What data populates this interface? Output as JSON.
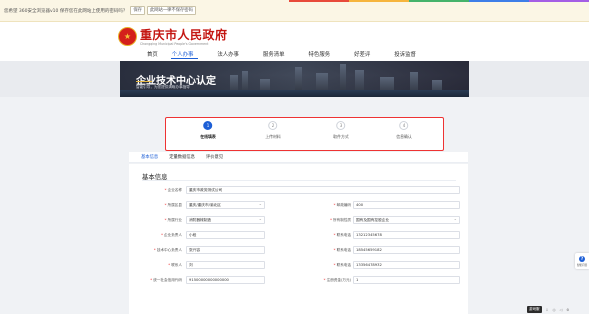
{
  "password_bar": {
    "message": "您希望 360安全浏览器v10 保存您在此网站上使用的密码吗？",
    "save_button": "保存",
    "other_button": "此网站一律不保存密码",
    "accent_colors": [
      "#e84a3b",
      "#f6b53d",
      "#45b36b",
      "#3d7ee8",
      "#a45ee5"
    ]
  },
  "header": {
    "site_name": "重庆市人民政府",
    "site_name_en": "Chongqing Municipal People's Government",
    "nav": [
      {
        "label": "首页",
        "active": false
      },
      {
        "label": "个人办事",
        "active": true
      },
      {
        "label": "法人办事",
        "active": false
      },
      {
        "label": "服务清单",
        "active": false
      },
      {
        "label": "特色服务",
        "active": false
      },
      {
        "label": "好差评",
        "active": false
      },
      {
        "label": "投诉监督",
        "active": false
      }
    ]
  },
  "banner": {
    "title": "企业技术中心认定",
    "subtitle": "智能引导，为您提供清晰办事指导"
  },
  "steps": [
    {
      "number": "1",
      "label": "在线填表",
      "active": true
    },
    {
      "number": "2",
      "label": "上传材料",
      "active": false
    },
    {
      "number": "3",
      "label": "取件方式",
      "active": false
    },
    {
      "number": "4",
      "label": "信息确认",
      "active": false
    }
  ],
  "tabs": [
    {
      "label": "基本信息",
      "active": true
    },
    {
      "label": "定量数据信息",
      "active": false
    },
    {
      "label": "评价意见",
      "active": false
    }
  ],
  "form": {
    "section_title": "基本信息",
    "fields_left": [
      {
        "label": "企业名称",
        "value": "重庆市政务测试公司",
        "required": true,
        "select": false,
        "wide": true
      },
      {
        "label": "所属区县",
        "value": "重庆/重庆市/渝北区",
        "required": true,
        "select": true
      },
      {
        "label": "所属行业",
        "value": "消防器械制造",
        "required": true,
        "select": true
      },
      {
        "label": "企业负责人",
        "value": "小段",
        "required": true,
        "select": false
      },
      {
        "label": "技术中心负责人",
        "value": "张兴容",
        "required": true,
        "select": false
      },
      {
        "label": "联系人",
        "value": "刘",
        "required": true,
        "select": false
      },
      {
        "label": "统一社会信用代码",
        "value": "91500000000000000",
        "required": true,
        "select": false
      }
    ],
    "fields_right": [
      {
        "label": "邮政编码",
        "value": "400",
        "required": true,
        "select": false
      },
      {
        "label": "所有制性质",
        "value": "国有及国有控股企业",
        "required": true,
        "select": true
      },
      {
        "label": "联系电话",
        "value": "13212345678",
        "required": true,
        "select": false
      },
      {
        "label": "联系电话",
        "value": "18545659182",
        "required": true,
        "select": false
      },
      {
        "label": "联系电话",
        "value": "13356478932",
        "required": true,
        "select": false
      },
      {
        "label": "注册资金(万元)",
        "value": "1",
        "required": true,
        "select": false
      }
    ]
  },
  "float_help": {
    "label": "智能问答"
  },
  "bottom_toolbar": {
    "button": "游戏服",
    "icons": [
      "download-icon",
      "headset-icon",
      "speaker-icon",
      "settings-icon"
    ]
  }
}
